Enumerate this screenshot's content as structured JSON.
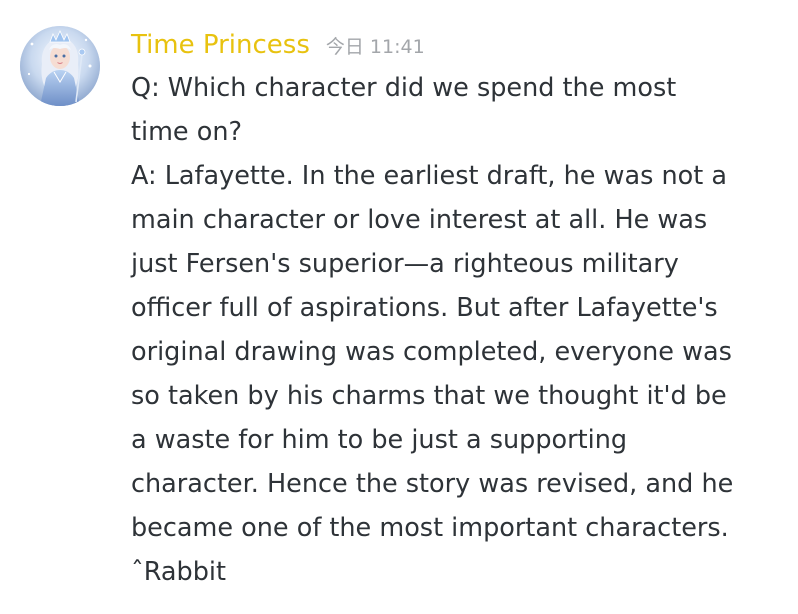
{
  "message": {
    "author": "Time Princess",
    "timestamp": "今日 11:41",
    "author_color": "#e8c20f",
    "text_color": "#2e3338",
    "timestamp_color": "#a3a6aa",
    "avatar_icon": "time-princess-avatar",
    "lines": [
      "Q: Which character did we spend the most",
      "time on?",
      "A: Lafayette. In the earliest draft, he was not a",
      "main character or love interest at all. He was",
      "just Fersen's superior—a righteous military",
      "officer full of aspirations. But after Lafayette's",
      "original drawing was completed, everyone was",
      "so taken by his charms that we thought it'd be",
      "a waste for him to be just a supporting",
      "character. Hence the story was revised, and he",
      "became one of the most important characters.",
      "ˆRabbit"
    ]
  }
}
